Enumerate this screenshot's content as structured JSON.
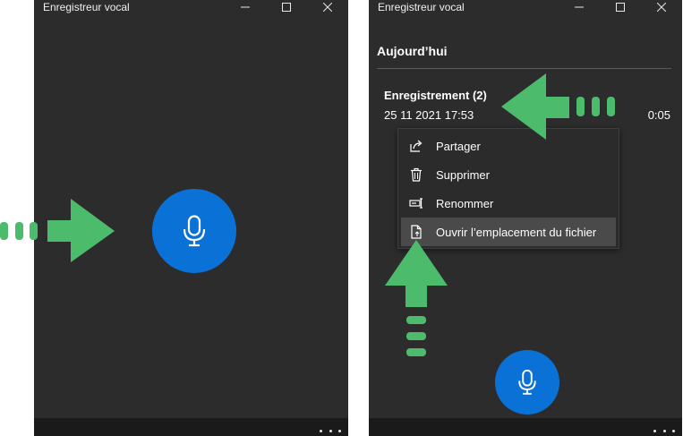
{
  "left_window": {
    "title": "Enregistreur vocal"
  },
  "right_window": {
    "title": "Enregistreur vocal",
    "section_header": "Aujourd’hui",
    "recording": {
      "name": "Enregistrement (2)",
      "date": "25 11 2021 17:53",
      "duration": "0:05"
    },
    "context_menu": {
      "items": [
        {
          "label": "Partager",
          "icon": "share-icon"
        },
        {
          "label": "Supprimer",
          "icon": "trash-icon"
        },
        {
          "label": "Renommer",
          "icon": "rename-icon"
        },
        {
          "label": "Ouvrir l’emplacement du fichier",
          "icon": "open-file-location-icon"
        }
      ],
      "highlighted_index": 3
    }
  },
  "colors": {
    "window_bg": "#2c2c2c",
    "accent_blue": "#0a72d6",
    "annotation_green": "#4cbb6c",
    "menu_hover": "#4a4a4a"
  }
}
